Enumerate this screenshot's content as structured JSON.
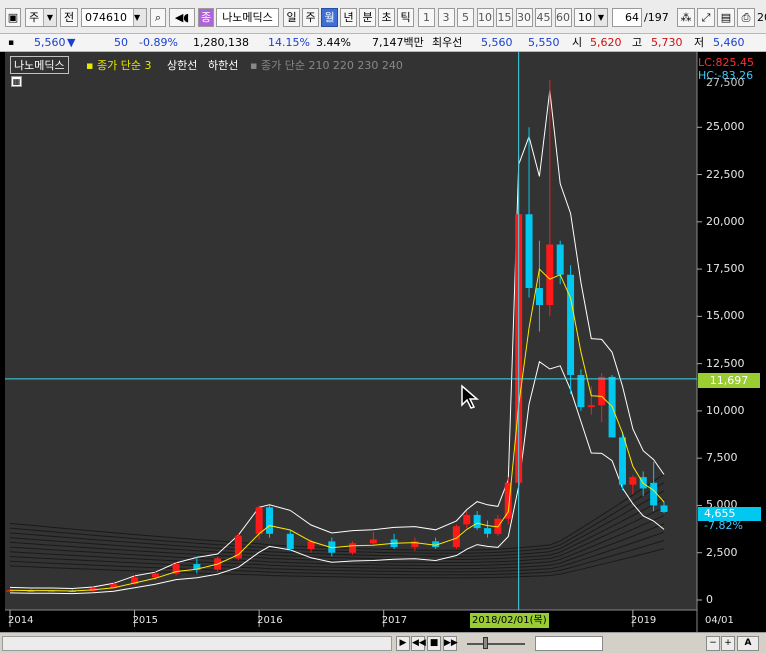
{
  "toolbar": {
    "market_type": "주",
    "range_btn": "전",
    "stock_code": "074610",
    "stock_name": "나노메딕스",
    "period_tabs": [
      {
        "label": "일",
        "selected": false
      },
      {
        "label": "주",
        "selected": false
      },
      {
        "label": "월",
        "selected": true
      },
      {
        "label": "년",
        "selected": false
      },
      {
        "label": "분",
        "selected": false
      },
      {
        "label": "초",
        "selected": false
      },
      {
        "label": "틱",
        "selected": false
      }
    ],
    "intervals": [
      "1",
      "3",
      "5",
      "10",
      "15",
      "30",
      "45",
      "60"
    ],
    "interval_select": "10",
    "page_current": "64",
    "page_total": "/197",
    "edge_label": "20"
  },
  "quote": {
    "price": "5,560",
    "direction": "▼",
    "change": "50",
    "change_pct": "-0.89%",
    "volume": "1,280,138",
    "turnover_pct": "14.15%",
    "ratio_pct": "3.44%",
    "amount": "7,147백만",
    "priority_label": "최우선",
    "priority_ask": "5,560",
    "priority_bid": "5,550",
    "open_label": "시",
    "open": "5,620",
    "high_label": "고",
    "high": "5,730",
    "low_label": "저",
    "low": "5,460"
  },
  "legend": {
    "name": "나노메딕스",
    "ma_short": "종가 단순 3",
    "upper": "상한선",
    "lower": "하한선",
    "ma_long": "종가 단순 210 220 230 240"
  },
  "y_axis": {
    "ticks": [
      "25,000",
      "22,500",
      "20,000",
      "17,500",
      "15,000",
      "12,500",
      "10,000",
      "7,500",
      "5,000",
      "2,500",
      "0"
    ],
    "top_partial": "27,500",
    "lc_label": "LC:825.45",
    "hc_label": "HC:-83.26",
    "crosshair_value": "11,697",
    "current_price": "4,655",
    "current_pct": "-7.82%"
  },
  "x_axis": {
    "labels": [
      "2014",
      "2015",
      "2016",
      "2017",
      "2019"
    ],
    "crosshair_date": "2018/02/01(목)",
    "right_label": "04/01"
  },
  "colors": {
    "up": "#ff1a1a",
    "down": "#00c8f0",
    "ma_short": "#ffe800",
    "band": "#ffffff",
    "crosshair": "#3fd6e8",
    "crosshair_tag": "#9acd32"
  },
  "chart_data": {
    "type": "candlestick",
    "title": "나노메딕스",
    "interval": "monthly",
    "ylim": [
      0,
      27500
    ],
    "x_range": [
      "2014-01",
      "2019-04"
    ],
    "candles": [
      {
        "date": "2014-01",
        "o": 480,
        "h": 560,
        "l": 440,
        "c": 520
      },
      {
        "date": "2014-03",
        "o": 520,
        "h": 560,
        "l": 440,
        "c": 470
      },
      {
        "date": "2014-05",
        "o": 470,
        "h": 540,
        "l": 430,
        "c": 500
      },
      {
        "date": "2014-07",
        "o": 500,
        "h": 560,
        "l": 430,
        "c": 450
      },
      {
        "date": "2014-09",
        "o": 480,
        "h": 700,
        "l": 440,
        "c": 650
      },
      {
        "date": "2014-11",
        "o": 650,
        "h": 900,
        "l": 600,
        "c": 850
      },
      {
        "date": "2015-01",
        "o": 850,
        "h": 1300,
        "l": 800,
        "c": 1200
      },
      {
        "date": "2015-03",
        "o": 1200,
        "h": 1500,
        "l": 1050,
        "c": 1400
      },
      {
        "date": "2015-05",
        "o": 1400,
        "h": 2000,
        "l": 1300,
        "c": 1900
      },
      {
        "date": "2015-07",
        "o": 1900,
        "h": 2300,
        "l": 1400,
        "c": 1600
      },
      {
        "date": "2015-09",
        "o": 1600,
        "h": 2300,
        "l": 1500,
        "c": 2200
      },
      {
        "date": "2015-11",
        "o": 2200,
        "h": 3500,
        "l": 2100,
        "c": 3400
      },
      {
        "date": "2016-01",
        "o": 3500,
        "h": 5000,
        "l": 3200,
        "c": 4900
      },
      {
        "date": "2016-02",
        "o": 4900,
        "h": 5000,
        "l": 3300,
        "c": 3500
      },
      {
        "date": "2016-04",
        "o": 3500,
        "h": 3700,
        "l": 2600,
        "c": 2700
      },
      {
        "date": "2016-06",
        "o": 2700,
        "h": 3200,
        "l": 2500,
        "c": 3100
      },
      {
        "date": "2016-08",
        "o": 3100,
        "h": 3300,
        "l": 2300,
        "c": 2500
      },
      {
        "date": "2016-10",
        "o": 2500,
        "h": 3100,
        "l": 2400,
        "c": 3000
      },
      {
        "date": "2016-12",
        "o": 3000,
        "h": 3600,
        "l": 2900,
        "c": 3200
      },
      {
        "date": "2017-02",
        "o": 3200,
        "h": 3500,
        "l": 2700,
        "c": 2800
      },
      {
        "date": "2017-04",
        "o": 2800,
        "h": 3300,
        "l": 2600,
        "c": 3100
      },
      {
        "date": "2017-06",
        "o": 3100,
        "h": 3300,
        "l": 2700,
        "c": 2800
      },
      {
        "date": "2017-08",
        "o": 2800,
        "h": 4000,
        "l": 2700,
        "c": 3900
      },
      {
        "date": "2017-09",
        "o": 4000,
        "h": 4700,
        "l": 3800,
        "c": 4500
      },
      {
        "date": "2017-10",
        "o": 4500,
        "h": 4700,
        "l": 3700,
        "c": 3800
      },
      {
        "date": "2017-11",
        "o": 3800,
        "h": 4200,
        "l": 3300,
        "c": 3500
      },
      {
        "date": "2017-12",
        "o": 3500,
        "h": 4500,
        "l": 3400,
        "c": 4300
      },
      {
        "date": "2018-01",
        "o": 4300,
        "h": 6500,
        "l": 4000,
        "c": 6200
      },
      {
        "date": "2018-02",
        "o": 6200,
        "h": 23500,
        "l": 5900,
        "c": 20400
      },
      {
        "date": "2018-03",
        "o": 20400,
        "h": 25000,
        "l": 16000,
        "c": 16500
      },
      {
        "date": "2018-04",
        "o": 16500,
        "h": 19000,
        "l": 14200,
        "c": 15600
      },
      {
        "date": "2018-05",
        "o": 15600,
        "h": 27500,
        "l": 15000,
        "c": 18800
      },
      {
        "date": "2018-06",
        "o": 18800,
        "h": 19000,
        "l": 16700,
        "c": 17200
      },
      {
        "date": "2018-07",
        "o": 17200,
        "h": 17700,
        "l": 10900,
        "c": 11900
      },
      {
        "date": "2018-08",
        "o": 11900,
        "h": 12200,
        "l": 10000,
        "c": 10200
      },
      {
        "date": "2018-09",
        "o": 10200,
        "h": 11300,
        "l": 9800,
        "c": 10300
      },
      {
        "date": "2018-10",
        "o": 10300,
        "h": 12000,
        "l": 9400,
        "c": 11800
      },
      {
        "date": "2018-11",
        "o": 11800,
        "h": 11900,
        "l": 9500,
        "c": 8600
      },
      {
        "date": "2018-12",
        "o": 8600,
        "h": 8900,
        "l": 5800,
        "c": 6100
      },
      {
        "date": "2019-01",
        "o": 6100,
        "h": 6600,
        "l": 5600,
        "c": 6500
      },
      {
        "date": "2019-02",
        "o": 6500,
        "h": 6800,
        "l": 5500,
        "c": 5900
      },
      {
        "date": "2019-03",
        "o": 6200,
        "h": 7300,
        "l": 4700,
        "c": 5000
      },
      {
        "date": "2019-04",
        "o": 5000,
        "h": 5200,
        "l": 4600,
        "c": 4655
      }
    ]
  }
}
